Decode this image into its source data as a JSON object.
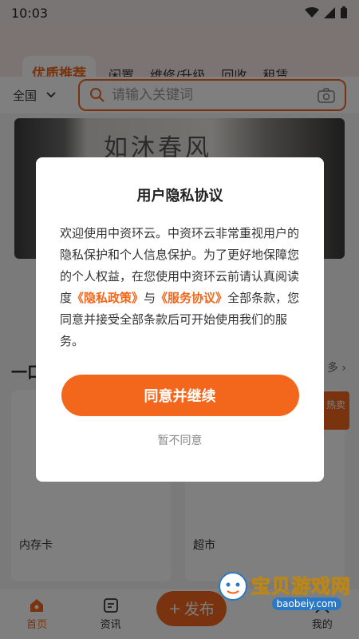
{
  "status_bar": {
    "time": "10:03"
  },
  "top_tabs": [
    "优质推荐",
    "闲置",
    "维修/升级",
    "回收",
    "租赁"
  ],
  "region_selector": {
    "label": "全国"
  },
  "search": {
    "placeholder": "请输入关键词"
  },
  "banner": {
    "text": "如沐春风"
  },
  "section": {
    "title": "一口",
    "more": "多 ›"
  },
  "cards": [
    {
      "label": "内存卡"
    },
    {
      "label": "超市"
    }
  ],
  "card_badge": "热卖",
  "bottom_nav": {
    "home": "首页",
    "news": "资讯",
    "publish": "发布",
    "mine": "我的"
  },
  "dialog": {
    "title": "用户隐私协议",
    "body_part1": "欢迎使用中资环云。中资环云非常重视用户的隐私保护和个人信息保护。为了更好地保障您的个人权益，在您使用中资环云前请认真阅读度",
    "privacy_link": "《隐私政策》",
    "body_part2": "与",
    "service_link": "《服务协议》",
    "body_part3": "全部条款，您同意并接受全部条款后可开始使用我们的服务。",
    "agree_button": "同意并继续",
    "decline_button": "暂不同意"
  },
  "watermark": {
    "main": "宝贝游戏网",
    "sub": "baobeiy.com"
  },
  "colors": {
    "accent": "#f2671c",
    "overlay": "rgba(0,0,0,0.5)"
  }
}
